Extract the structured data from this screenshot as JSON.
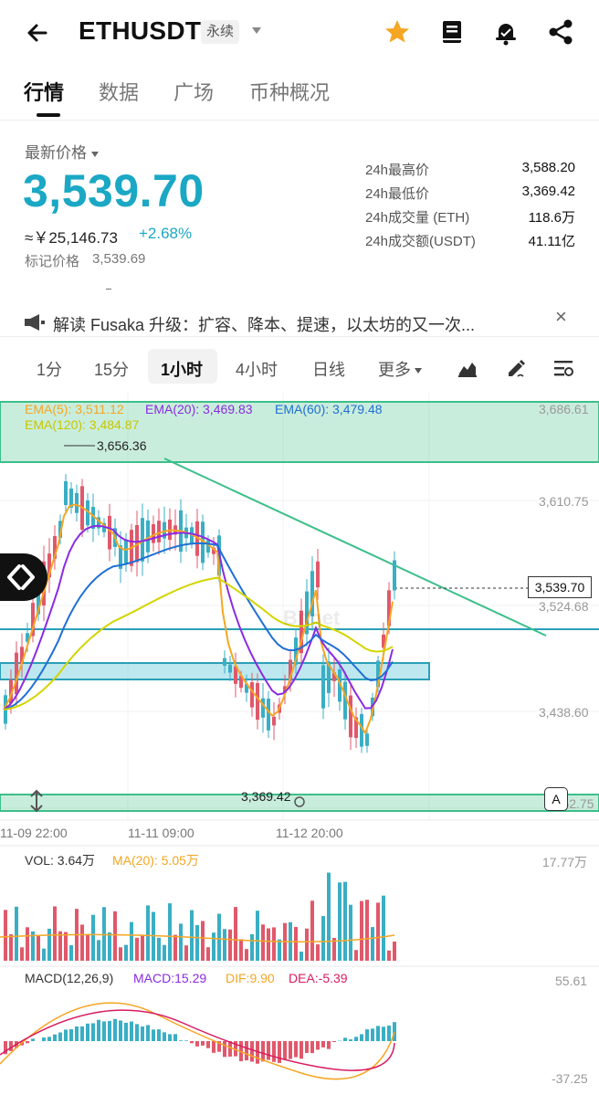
{
  "header": {
    "back_icon": "arrow-left-icon",
    "symbol": "ETHUSDT",
    "contract_tag": "永续",
    "icons": [
      "star-icon",
      "book-icon",
      "bell-icon",
      "share-icon"
    ],
    "star_color": "#f5a623"
  },
  "tabs": [
    {
      "label": "行情",
      "active": true
    },
    {
      "label": "数据",
      "active": false
    },
    {
      "label": "广场",
      "active": false
    },
    {
      "label": "币种概况",
      "active": false
    }
  ],
  "price": {
    "latest_label": "最新价格",
    "last_price": "3,539.70",
    "cny_equiv": "≈￥25,146.73",
    "change_pct": "+2.68%",
    "mark_label": "标记价格",
    "mark_price": "3,539.69",
    "accent_color": "#1aa8c4"
  },
  "stats": [
    {
      "key": "24h最高价",
      "value": "3,588.20"
    },
    {
      "key": "24h最低价",
      "value": "3,369.42"
    },
    {
      "key": "24h成交量 (ETH)",
      "value": "118.6万"
    },
    {
      "key": "24h成交额(USDT)",
      "value": "41.11亿"
    }
  ],
  "news": {
    "icon": "speaker-icon",
    "text": "解读 Fusaka 升级：扩容、降本、提速，以太坊的又一次...",
    "close": "×"
  },
  "timeframes": {
    "items": [
      "1分",
      "15分",
      "1小时",
      "4小时",
      "日线",
      "更多"
    ],
    "active": "1小时",
    "tool_icons": [
      "chart-type-icon",
      "draw-pen-icon",
      "indicator-settings-icon"
    ]
  },
  "chart": {
    "ema5": "EMA(5): 3,511.12",
    "ema20": "EMA(20): 3,469.83",
    "ema60": "EMA(60): 3,479.48",
    "ema120": "EMA(120): 3,484.87",
    "y_labels": [
      "3,686.61",
      "3,610.75",
      "3,524.68",
      "3,438.60",
      "3,352.75"
    ],
    "high_marker": "3,656.36",
    "low_marker": "3,369.42",
    "last_price_tag": "3,539.70",
    "x_labels": [
      "11-09 22:00",
      "11-11 09:00",
      "11-12 20:00"
    ],
    "auto_badge": "A",
    "watermark": "Bitget",
    "colors": {
      "ema5": "#f5a623",
      "ema20": "#8a2be2",
      "ema60": "#1f6fd6",
      "ema120": "#d4d400",
      "up": "#3aaec4",
      "down": "#e0596b"
    }
  },
  "volume": {
    "vol_label": "VOL: 3.64万",
    "ma_label": "MA(20): 5.05万",
    "max_label": "17.77万"
  },
  "macd": {
    "params": "MACD(12,26,9)",
    "macd": "MACD:15.29",
    "dif": "DIF:9.90",
    "dea": "DEA:-5.39",
    "top_label": "55.61",
    "bottom_label": "-37.25"
  }
}
